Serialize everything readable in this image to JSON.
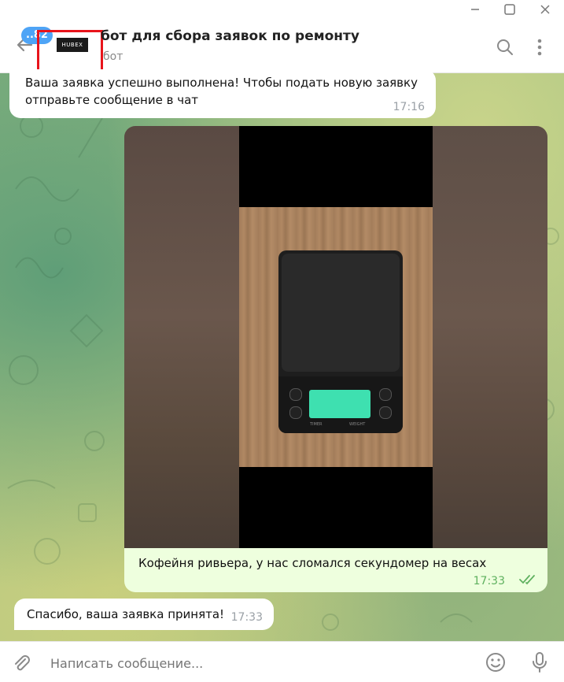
{
  "window": {
    "minimize_icon": "minimize-icon",
    "maximize_icon": "maximize-icon",
    "close_icon": "close-icon"
  },
  "header": {
    "unread_count": "..82",
    "avatar_text": "HUBEX",
    "title": "бот для сбора заявок по ремонту",
    "subtitle": "бот"
  },
  "messages": [
    {
      "text_line1": "Ваша заявка успешно выполнена! Чтобы подать новую заявку",
      "text_line2": "отправьте сообщение в чат",
      "time": "17:16"
    },
    {
      "caption": "Кофейня ривьера, у нас сломался секундомер на весах",
      "time": "17:33",
      "status": "read"
    },
    {
      "text": "Спасибо, ваша заявка принята!",
      "time": "17:33"
    }
  ],
  "photo": {
    "lcd_labels": [
      "TIMER",
      "WEIGHT"
    ]
  },
  "composer": {
    "placeholder": "Написать сообщение..."
  },
  "colors": {
    "accent": "#4ea4f6",
    "outgoing_bubble": "#eeffde",
    "read_check": "#5fb15f",
    "highlight": "#e8141b"
  }
}
